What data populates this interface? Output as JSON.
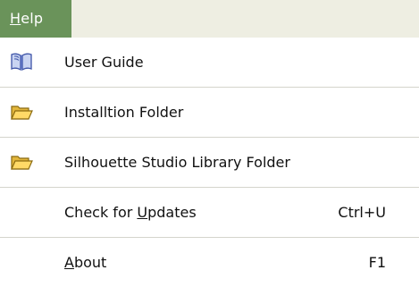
{
  "menubar": {
    "menu_label_mnemonic": "H",
    "menu_label_rest": "elp",
    "bg_color": "#eeeee2",
    "active_color": "#6a935a"
  },
  "menu": {
    "items": [
      {
        "icon": "book-icon",
        "label": "User Guide",
        "shortcut": ""
      },
      {
        "icon": "folder-icon",
        "label": "Installtion Folder",
        "shortcut": ""
      },
      {
        "icon": "folder-icon",
        "label": "Silhouette Studio Library Folder",
        "shortcut": ""
      },
      {
        "icon": "",
        "label_before": "Check for ",
        "label_mnemonic": "U",
        "label_after": "pdates",
        "shortcut": "Ctrl+U"
      },
      {
        "icon": "",
        "label_before": "",
        "label_mnemonic": "A",
        "label_after": "bout",
        "shortcut": "F1"
      }
    ]
  }
}
